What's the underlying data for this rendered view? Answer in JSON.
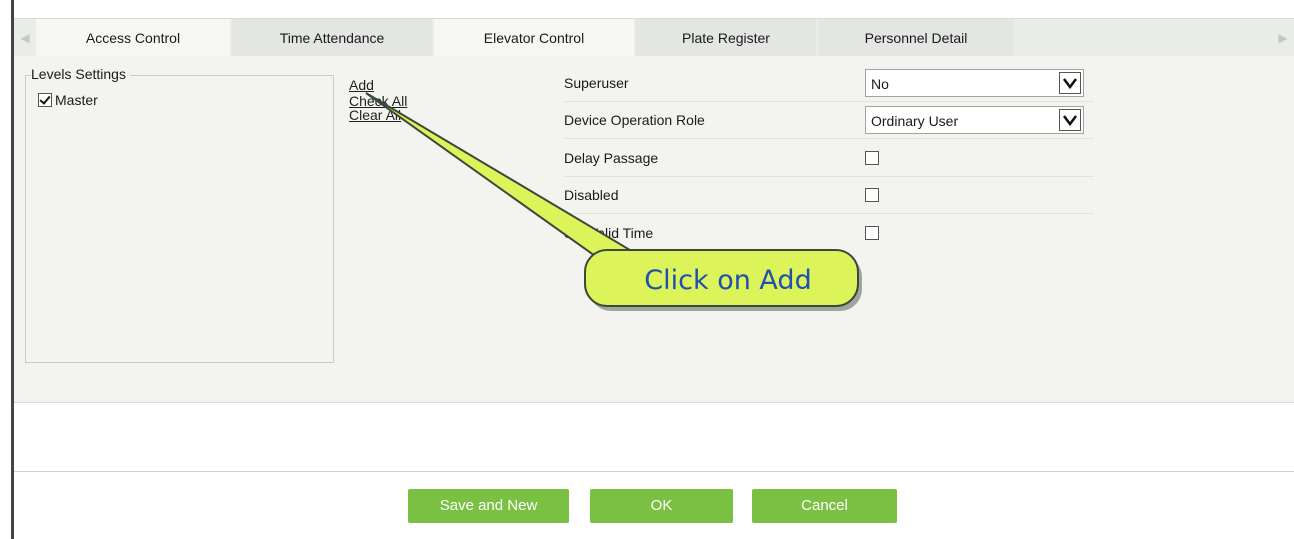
{
  "tabs": [
    {
      "label": "Access Control",
      "active": true
    },
    {
      "label": "Time Attendance",
      "active": false
    },
    {
      "label": "Elevator Control",
      "active": false
    },
    {
      "label": "Plate Register",
      "active": false
    },
    {
      "label": "Personnel Detail",
      "active": false
    }
  ],
  "levels": {
    "legend": "Levels Settings",
    "items": [
      {
        "label": "Master",
        "checked": true
      }
    ]
  },
  "links": {
    "add": "Add",
    "check_all": "Check All",
    "clear_all": "Clear All"
  },
  "fields": {
    "superuser": {
      "label": "Superuser",
      "value": "No"
    },
    "device_role": {
      "label": "Device Operation Role",
      "value": "Ordinary User"
    },
    "delay_passage": {
      "label": "Delay Passage",
      "checked": false
    },
    "disabled": {
      "label": "Disabled",
      "checked": false
    },
    "valid_time": {
      "label": "Set Valid Time",
      "checked": false
    }
  },
  "callout": {
    "text": "Click on Add",
    "fill": "#dcf35a",
    "text_color": "#1f4fb0"
  },
  "buttons": {
    "save_new": "Save and New",
    "ok": "OK",
    "cancel": "Cancel",
    "color": "#7ac143"
  }
}
